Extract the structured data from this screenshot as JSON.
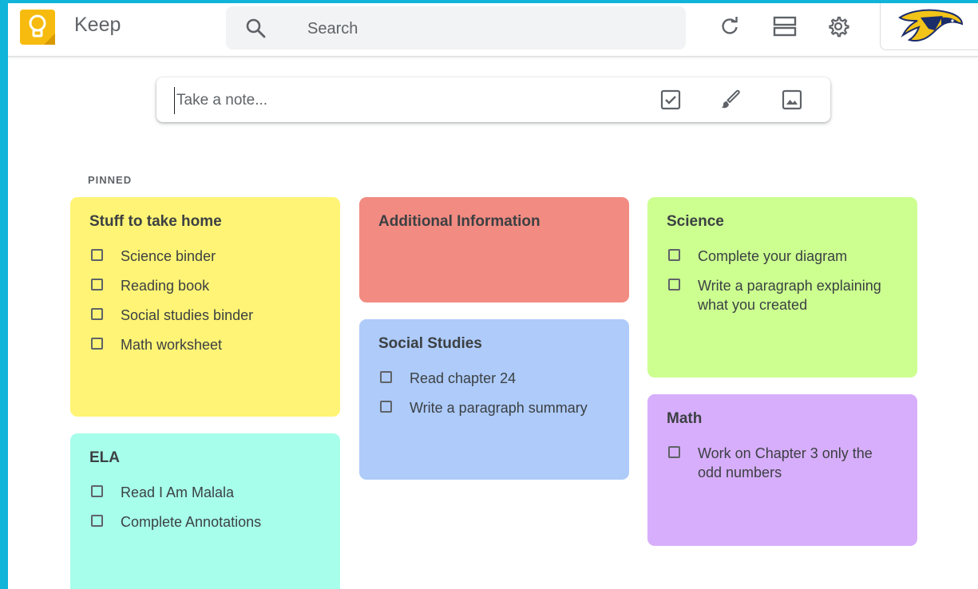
{
  "header": {
    "app_name": "Keep",
    "search_placeholder": "Search"
  },
  "take_note": {
    "placeholder": "Take a note..."
  },
  "section_label": "PINNED",
  "notes": [
    {
      "title": "Stuff to take home",
      "color": "#fff475",
      "items": [
        "Science binder",
        "Reading book",
        "Social studies binder",
        "Math worksheet"
      ]
    },
    {
      "title": "Additional Information",
      "color": "#f28b82",
      "items": []
    },
    {
      "title": "Science",
      "color": "#ccff90",
      "items": [
        "Complete your diagram",
        "Write a paragraph explaining what you created"
      ]
    },
    {
      "title": "Social Studies",
      "color": "#aecbfa",
      "items": [
        "Read chapter 24",
        "Write a paragraph summary"
      ]
    },
    {
      "title": "ELA",
      "color": "#a7ffeb",
      "items": [
        "Read I Am Malala",
        "Complete Annotations"
      ]
    },
    {
      "title": "Math",
      "color": "#d7aefb",
      "items": [
        "Work on Chapter 3 only the odd numbers"
      ]
    }
  ],
  "icons": {
    "logo": "keep-bulb-icon",
    "search": "search-icon",
    "refresh": "refresh-icon",
    "layout": "list-view-icon",
    "settings": "gear-icon",
    "account": "account-logo",
    "checkbox_note": "checkbox-icon",
    "drawing_note": "brush-icon",
    "image_note": "image-icon"
  }
}
